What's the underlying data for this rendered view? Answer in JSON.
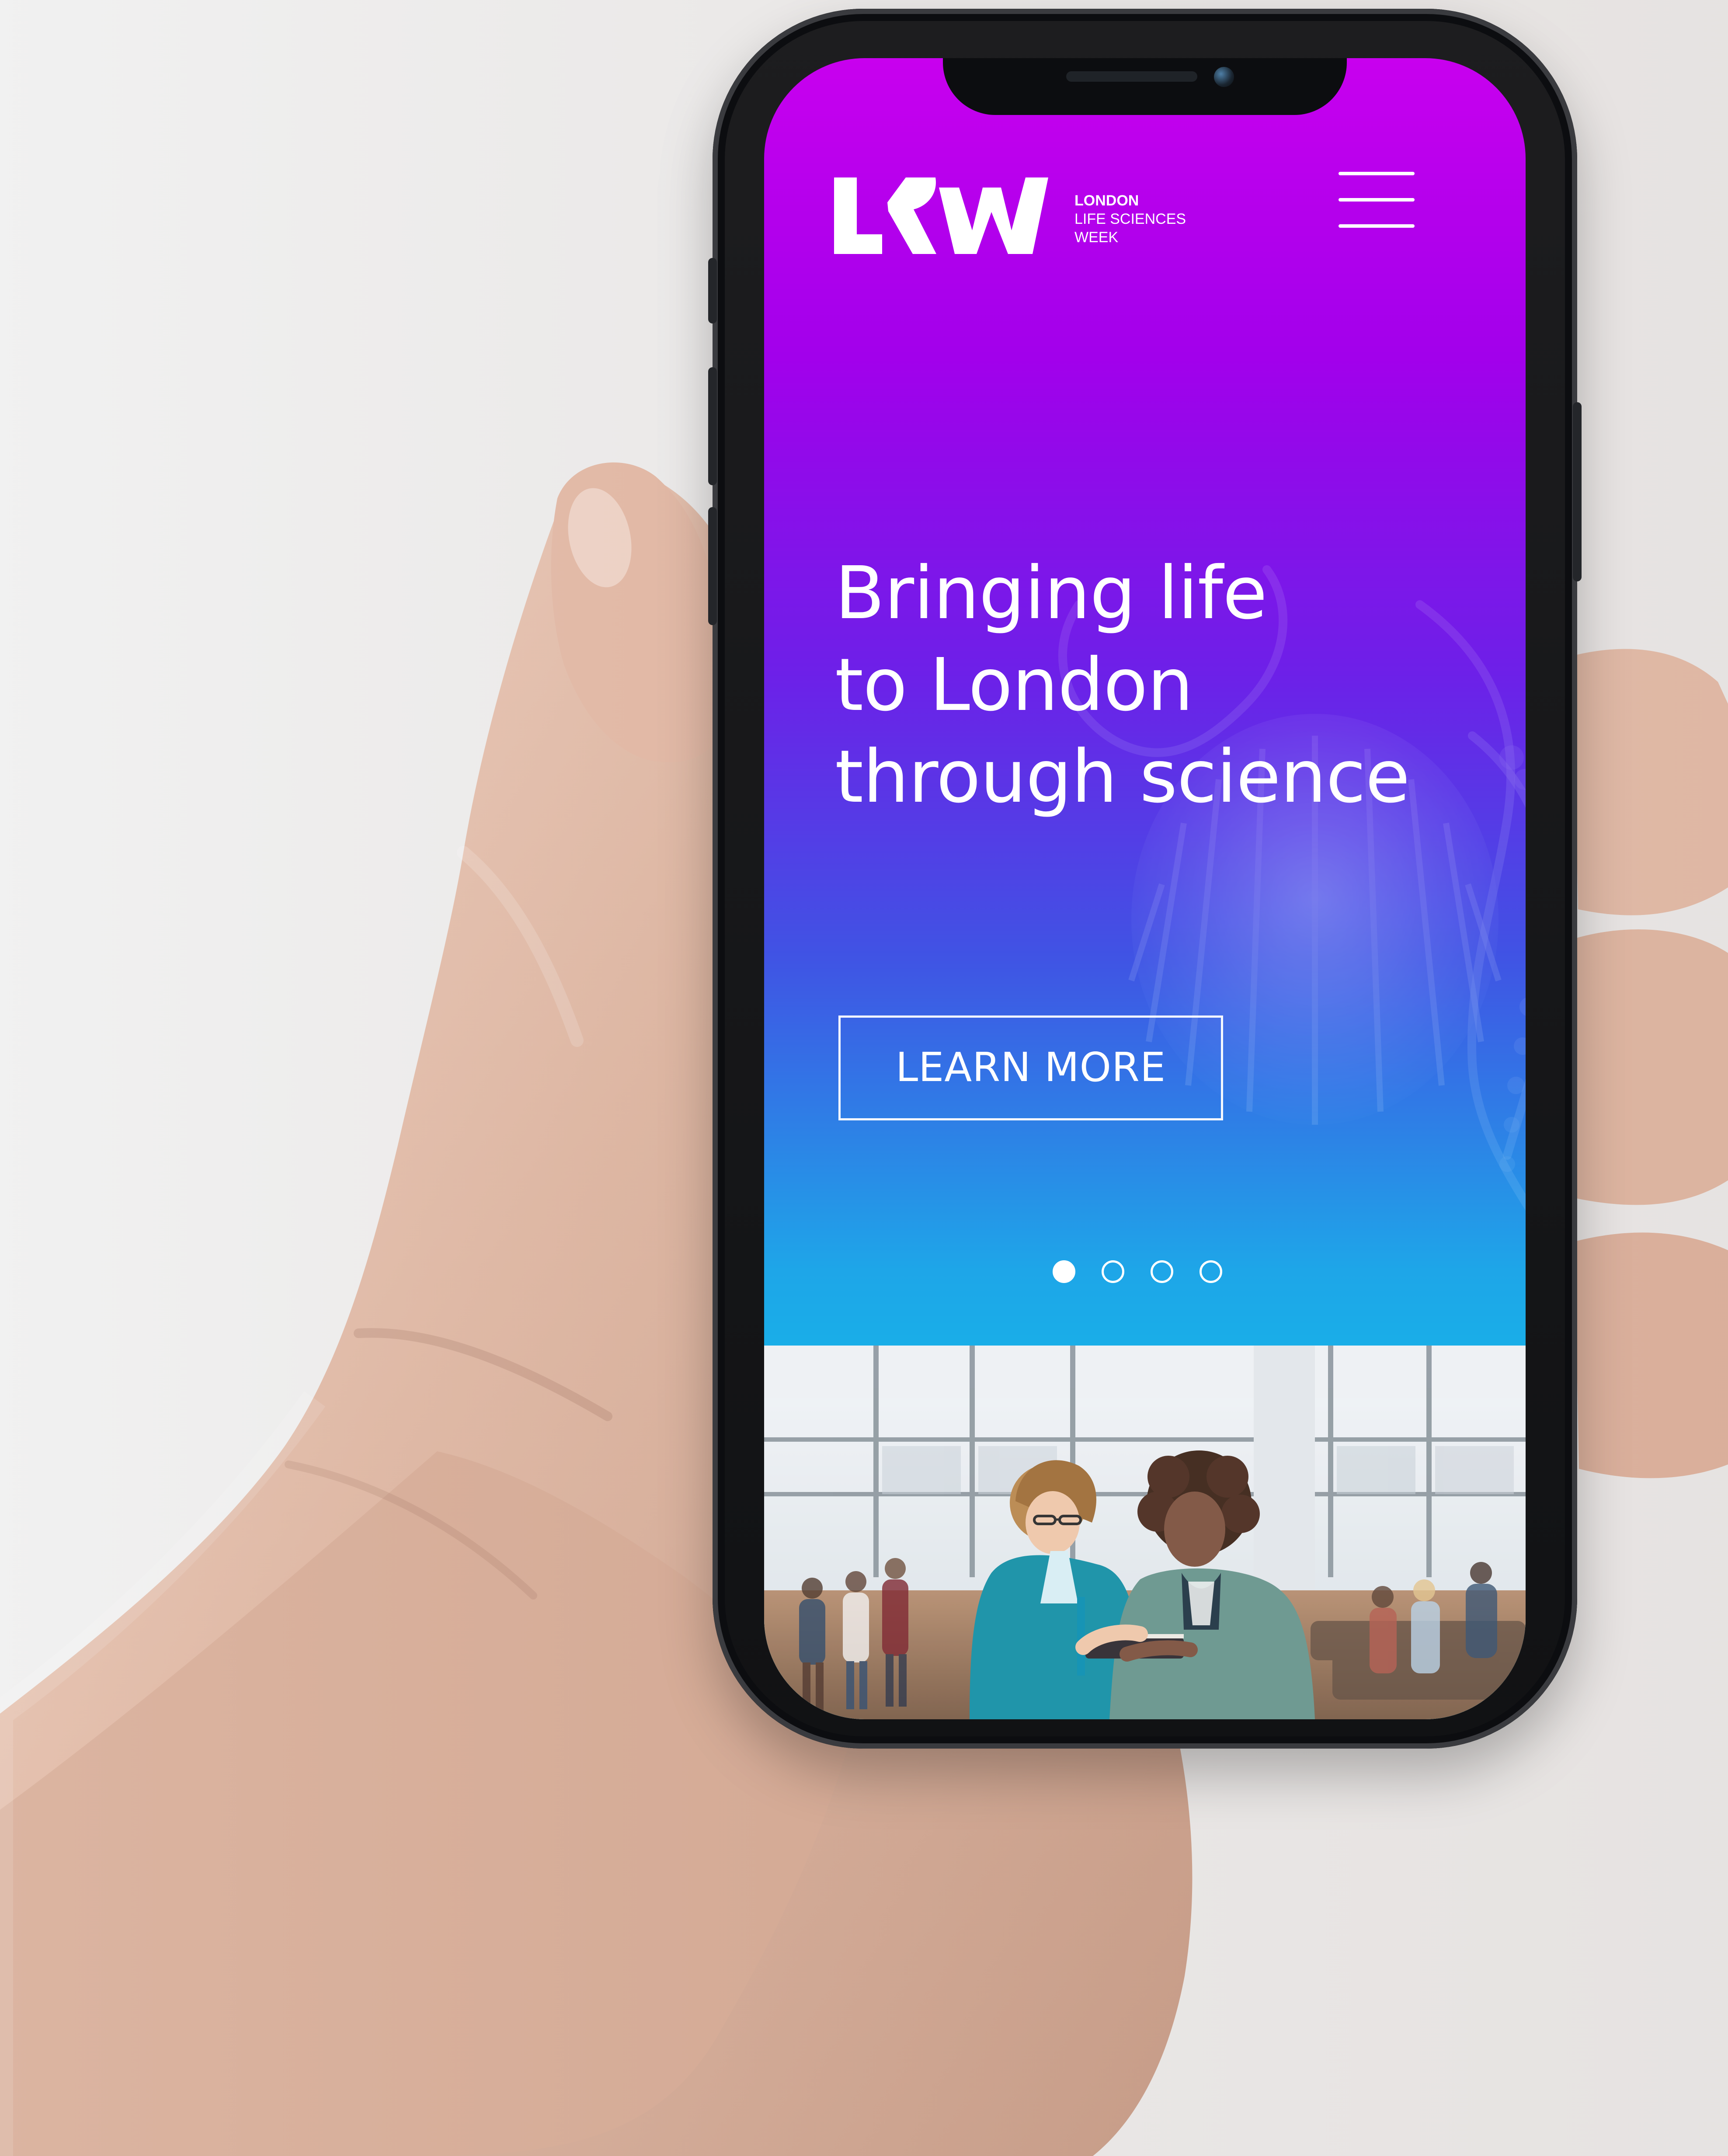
{
  "site": {
    "logo_lines": [
      "LONDON",
      "LIFE SCIENCES",
      "WEEK"
    ]
  },
  "hero": {
    "title_lines": [
      "Bringing life",
      "to London",
      "through science"
    ],
    "cta_label": "LEARN MORE"
  },
  "carousel": {
    "current_slide": 1,
    "slide_count": 4
  },
  "colors": {
    "background": "#efefef",
    "gradient_top": "#c800ee",
    "gradient_mid": "#4053e4",
    "gradient_bottom": "#00d4e8",
    "white": "#ffffff"
  }
}
